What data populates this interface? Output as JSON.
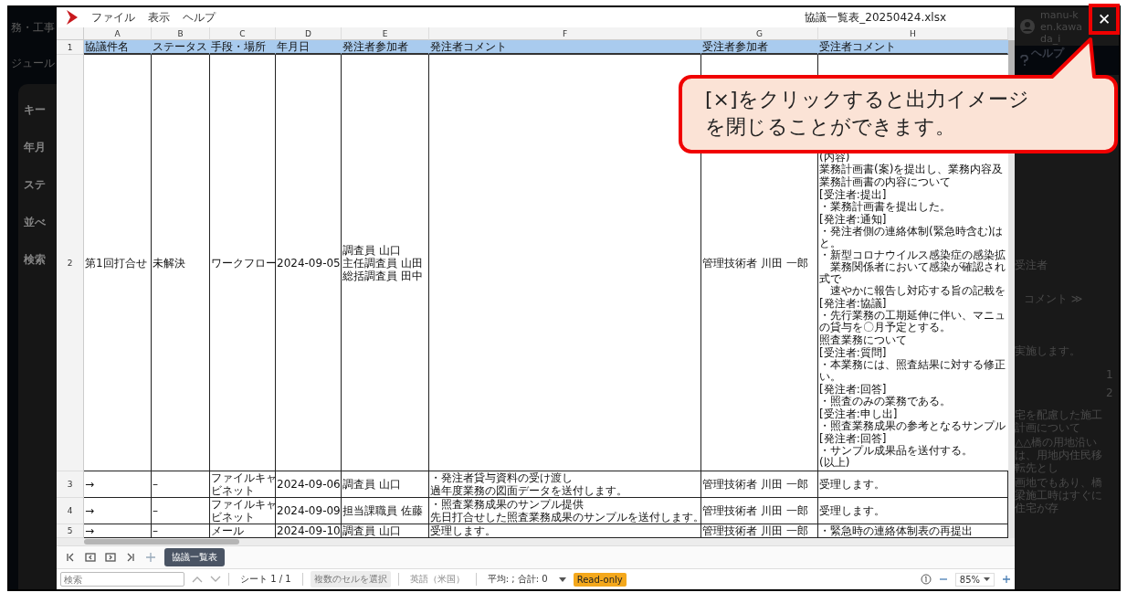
{
  "background": {
    "left_texts": [
      "務・工事",
      "ジュール",
      "キー",
      "年月",
      "ステ",
      "並べ",
      "検索"
    ],
    "user": "manu-ken.kawada_i",
    "help": "ヘルプ",
    "right_texts": [
      "受注者",
      "コメント ≫",
      "実施します。"
    ],
    "right_numbers": [
      "1",
      "2"
    ],
    "right_paragraph": [
      "宅を配慮した施工計画について",
      "△△橋の用地沿いは、用地内住民移転先とし",
      "画地でもあり、橋梁施工時はすぐに住宅が存"
    ]
  },
  "viewer": {
    "menu": [
      "ファイル",
      "表示",
      "ヘルプ"
    ],
    "file_title": "協議一覧表_20250424.xlsx",
    "columns": [
      "A",
      "B",
      "C",
      "D",
      "E",
      "F",
      "G",
      "H"
    ],
    "rows": [
      {
        "number": "1",
        "kind": "header",
        "cells": [
          {
            "kind": "text",
            "lines": [
              "協議件名"
            ]
          },
          {
            "kind": "text",
            "lines": [
              "ステータス"
            ]
          },
          {
            "kind": "text",
            "lines": [
              "手段・場所"
            ]
          },
          {
            "kind": "text",
            "lines": [
              "年月日"
            ]
          },
          {
            "kind": "text",
            "lines": [
              "発注者参加者"
            ]
          },
          {
            "kind": "text",
            "lines": [
              "発注者コメント"
            ]
          },
          {
            "kind": "text",
            "lines": [
              "受注者参加者"
            ]
          },
          {
            "kind": "text",
            "lines": [
              "受注者コメント"
            ]
          }
        ]
      },
      {
        "number": "2",
        "kind": "data",
        "cells": [
          {
            "kind": "text",
            "lines": [
              "第1回打合せ"
            ]
          },
          {
            "kind": "text",
            "lines": [
              "未解決"
            ]
          },
          {
            "kind": "text",
            "lines": [
              "ワークフロー"
            ]
          },
          {
            "kind": "text",
            "lines": [
              "2024-09-05"
            ]
          },
          {
            "kind": "text",
            "lines": [
              "調査員 山口",
              "主任調査員 山田",
              "総括調査員 田中"
            ]
          },
          {
            "kind": "text"
          },
          {
            "kind": "text",
            "lines": [
              "管理技術者 川田 一郎"
            ]
          },
          {
            "kind": "notes",
            "blocks": [
              [
                "(内容)",
                "業務計画書(案)を提出し、業務内容及"
              ],
              [
                "業務計画書の内容について"
              ],
              [
                "[受注者:提出]",
                "・業務計画書を提出した。"
              ],
              [
                "[発注者:通知]",
                "・発注者側の連絡体制(緊急時含む)は",
                "と。",
                "・新型コロナウイルス感染症の感染拡",
                "　業務関係者において感染が確認され",
                "式で",
                "　速やかに報告し対応する旨の記載を"
              ],
              [
                "[発注者:協議]",
                "・先行業務の工期延伸に伴い、マニュ",
                "の貸与を〇月予定とする。"
              ],
              [
                "照査業務について"
              ],
              [
                "[受注者:質問]",
                "・本業務には、照査結果に対する修正",
                "い。"
              ],
              [
                "[発注者:回答]",
                "・照査のみの業務である。"
              ],
              [
                "[受注者:申し出]",
                "・照査業務成果の参考となるサンプル"
              ],
              [
                "[発注者:回答]",
                "・サンプル成果品を送付する。",
                "(以上)"
              ]
            ]
          }
        ]
      },
      {
        "number": "3",
        "kind": "data",
        "cells": [
          {
            "kind": "text",
            "lines": [
              "→"
            ]
          },
          {
            "kind": "text",
            "lines": [
              "–"
            ]
          },
          {
            "kind": "text",
            "lines": [
              "ファイルキャ",
              "ビネット"
            ]
          },
          {
            "kind": "text",
            "lines": [
              "2024-09-06"
            ]
          },
          {
            "kind": "text",
            "lines": [
              "調査員 山口"
            ]
          },
          {
            "kind": "text",
            "lines": [
              "・発注者貸与資料の受け渡し",
              "過年度業務の図面データを送付します。"
            ]
          },
          {
            "kind": "text",
            "lines": [
              "管理技術者 川田 一郎"
            ]
          },
          {
            "kind": "text",
            "lines": [
              "受理します。"
            ]
          }
        ]
      },
      {
        "number": "4",
        "kind": "data",
        "cells": [
          {
            "kind": "text",
            "lines": [
              "→"
            ]
          },
          {
            "kind": "text",
            "lines": [
              "–"
            ]
          },
          {
            "kind": "text",
            "lines": [
              "ファイルキャ",
              "ビネット"
            ]
          },
          {
            "kind": "text",
            "lines": [
              "2024-09-09"
            ]
          },
          {
            "kind": "text",
            "lines": [
              "担当課職員 佐藤"
            ]
          },
          {
            "kind": "text",
            "lines": [
              "・照査業務成果のサンプル提供",
              "先日打合せした照査業務成果のサンプルを送付します。"
            ]
          },
          {
            "kind": "text",
            "lines": [
              "管理技術者 川田 一郎"
            ]
          },
          {
            "kind": "text",
            "lines": [
              "受理します。"
            ]
          }
        ]
      },
      {
        "number": "5",
        "kind": "data",
        "cells": [
          {
            "kind": "text",
            "lines": [
              "→"
            ]
          },
          {
            "kind": "text",
            "lines": [
              "–"
            ]
          },
          {
            "kind": "text",
            "lines": [
              "メール"
            ]
          },
          {
            "kind": "text",
            "lines": [
              "2024-09-10"
            ]
          },
          {
            "kind": "text",
            "lines": [
              "調査員 山口"
            ]
          },
          {
            "kind": "text",
            "lines": [
              "受理します。"
            ]
          },
          {
            "kind": "text",
            "lines": [
              "管理技術者 川田 一郎"
            ]
          },
          {
            "kind": "text",
            "lines": [
              "・緊急時の連絡体制表の再提出"
            ]
          }
        ]
      }
    ],
    "sheet_tabs": [
      {
        "label": "協議一覧表",
        "selected": true
      }
    ],
    "status": {
      "search_placeholder": "検索",
      "sheet": "シート 1 / 1",
      "multi_select": "複数のセルを選択",
      "language": "英語（米国）",
      "summary": "平均: ; 合計: 0",
      "badge": "Read-only",
      "zoom": "85%"
    }
  },
  "callout": {
    "lines": [
      "[×]をクリックすると出力イメージ",
      "を閉じることができます。"
    ]
  },
  "close_button": {
    "label": "✕"
  }
}
